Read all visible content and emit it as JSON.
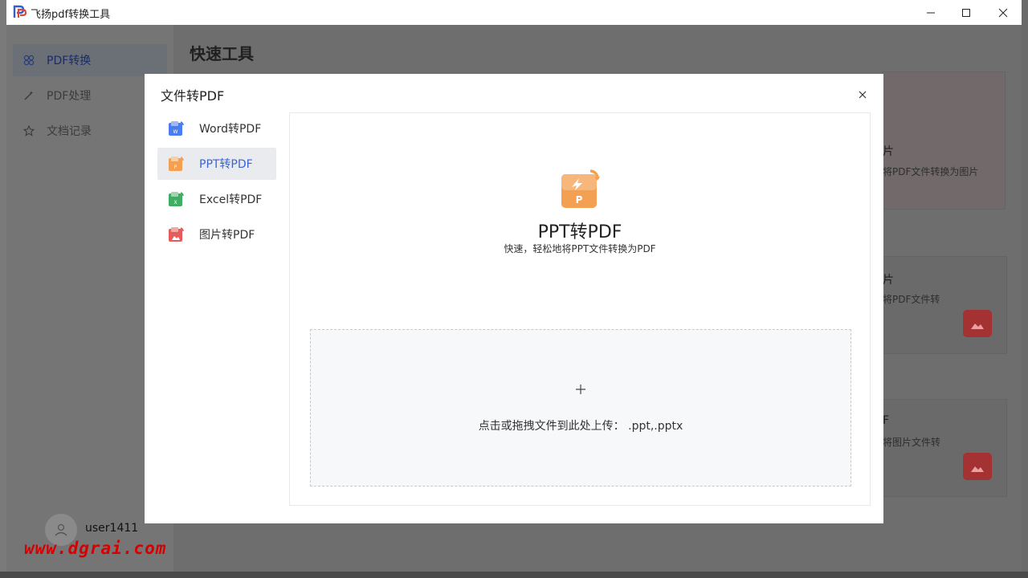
{
  "window": {
    "title": "飞扬pdf转换工具"
  },
  "sidebar": {
    "items": [
      {
        "label": "PDF转换",
        "icon": "grid-icon",
        "active": true
      },
      {
        "label": "PDF处理",
        "icon": "wand-icon",
        "active": false
      },
      {
        "label": "文档记录",
        "icon": "star-icon",
        "active": false
      }
    ],
    "user": "user1411"
  },
  "watermark": "www.dgrai.com",
  "main": {
    "title": "快速工具",
    "background_cards": [
      {
        "head": "片",
        "desc": "将PDF文件转换为图片"
      },
      {
        "head": "片",
        "desc": "将PDF文件转"
      },
      {
        "head": "F",
        "desc": "将图片文件转"
      }
    ]
  },
  "modal": {
    "title": "文件转PDF",
    "categories": [
      {
        "label": "Word转PDF",
        "icon": "word-file-icon",
        "color": "#4a7ef0"
      },
      {
        "label": "PPT转PDF",
        "icon": "ppt-file-icon",
        "color": "#f4a052",
        "active": true
      },
      {
        "label": "Excel转PDF",
        "icon": "excel-file-icon",
        "color": "#3fae62"
      },
      {
        "label": "图片转PDF",
        "icon": "image-file-icon",
        "color": "#e65b5b"
      }
    ],
    "panel": {
      "icon_letter": "P",
      "title": "PPT转PDF",
      "subtitle": "快速，轻松地将PPT文件转换为PDF",
      "upload_text": "点击或拖拽文件到此处上传： .ppt,.pptx"
    }
  },
  "colors": {
    "accent": "#3a64d8",
    "ppt": "#f4a052",
    "overlay": "#6e6e6e"
  }
}
